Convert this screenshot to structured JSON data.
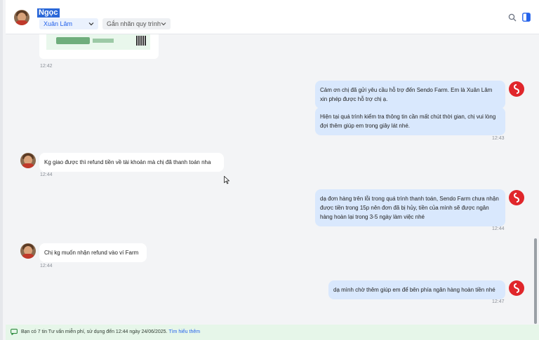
{
  "header": {
    "contact_name": "Ngọc",
    "assignee": "Xuân Lâm",
    "process_tag": "Gắn nhãn quy trình"
  },
  "messages": {
    "m0_time": "12:42",
    "m1_text": "Cảm ơn chị đã gửi yêu cầu hỗ trợ đến Sendo Farm. Em là Xuân Lâm xin phép được hỗ trợ chị ạ.",
    "m2_text": "Hiện tại quá trình kiểm tra thông tin cần mất chút thời gian, chị vui lòng đợi thêm giúp em trong giây lát nhé.",
    "m2_time": "12:43",
    "m3_text": "Kg giao được thì refund tiền về tài khoản mà chị đã thanh toán nha",
    "m3_time": "12:44",
    "m4_text": "dạ đơn hàng trên lỗi trong quá trình thanh toán, Sendo Farm chưa nhận được tiền trong 15p nên đơn đã bị hủy, tiền của mình sẽ được ngân hàng hoàn lại trong 3-5 ngày làm việc nhé",
    "m4_time": "12:44",
    "m5_text": "Chị kg muốn nhận refund vào ví Farm",
    "m5_time": "12:44",
    "m6_text": "dạ mình chờ thêm giúp em để bên phía ngân hàng hoàn tiền nhé",
    "m6_time": "12:47"
  },
  "footer": {
    "notice": "Bạn có 7 tin Tư vấn miễn phí, sử dụng đến 12:44 ngày 24/06/2025. ",
    "link": "Tìm hiểu thêm"
  },
  "icons": {
    "search": "search-icon",
    "panel": "side-panel-icon",
    "bot": "sendo-bot-icon"
  },
  "colors": {
    "accent": "#2563eb",
    "outgoing_bubble": "#d9e8fd",
    "bot_avatar": "#e0262b",
    "footer_bg": "#e6f6e9"
  }
}
